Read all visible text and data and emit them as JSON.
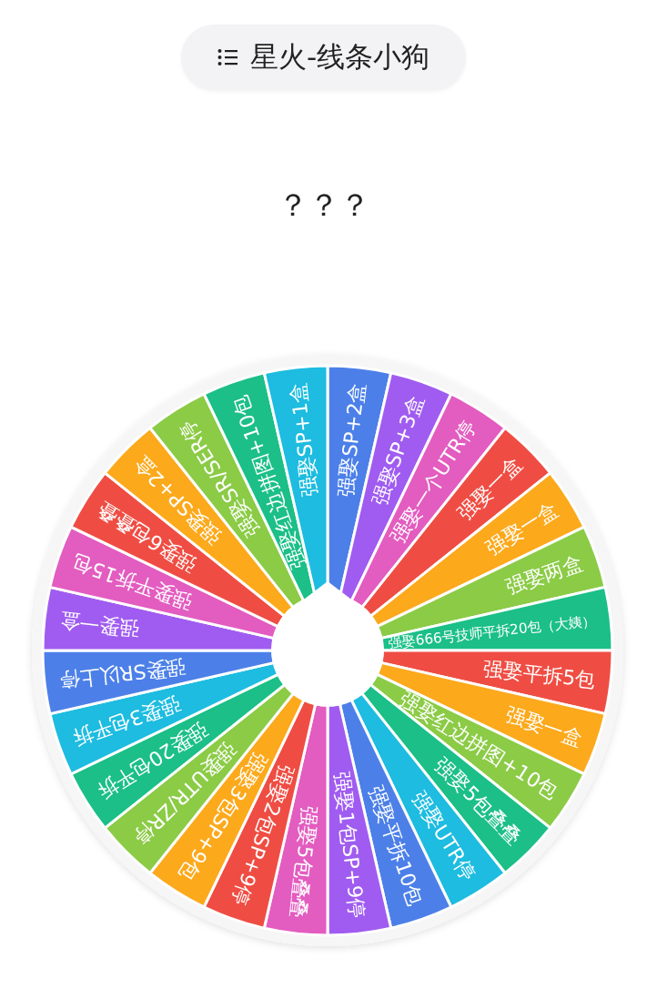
{
  "header": {
    "title": "星火-线条小狗"
  },
  "result": "？？？",
  "wheel": {
    "segments": [
      {
        "label": "强娶SP+2盒",
        "color": "#4c80e8"
      },
      {
        "label": "强娶SP+3盒",
        "color": "#a05cf0"
      },
      {
        "label": "强娶一个UTR停",
        "color": "#e35cc0"
      },
      {
        "label": "强娶一盒",
        "color": "#ef4d43"
      },
      {
        "label": "强娶一盒",
        "color": "#fca91c"
      },
      {
        "label": "强娶两盒",
        "color": "#8bcb46"
      },
      {
        "label": "强娶666号技师平拆20包（大姨）",
        "color": "#1bbf87"
      },
      {
        "label": "强娶平拆5包",
        "color": "#ef4d43"
      },
      {
        "label": "强娶一盒",
        "color": "#fca91c"
      },
      {
        "label": "强娶红边拼图+10包",
        "color": "#8bcb46"
      },
      {
        "label": "强娶5包叠叠",
        "color": "#1bbf87"
      },
      {
        "label": "强娶UTR停",
        "color": "#1dbce0"
      },
      {
        "label": "强娶平拆10包",
        "color": "#4c80e8"
      },
      {
        "label": "强娶1包SP+9停",
        "color": "#a05cf0"
      },
      {
        "label": "强娶5包叠叠",
        "color": "#e35cc0"
      },
      {
        "label": "强娶2包SP+9停",
        "color": "#ef4d43"
      },
      {
        "label": "强娶3包SP+9包",
        "color": "#fca91c"
      },
      {
        "label": "强娶UTR/ZR停",
        "color": "#8bcb46"
      },
      {
        "label": "强娶20包平拆",
        "color": "#1bbf87"
      },
      {
        "label": "强娶3包平拆",
        "color": "#1dbce0"
      },
      {
        "label": "强娶SR以上停",
        "color": "#4c80e8"
      },
      {
        "label": "强娶一盒",
        "color": "#a05cf0"
      },
      {
        "label": "强娶平拆15包",
        "color": "#e35cc0"
      },
      {
        "label": "强娶6包叠叠",
        "color": "#ef4d43"
      },
      {
        "label": "强娶SP+2盒",
        "color": "#fca91c"
      },
      {
        "label": "强娶SR/SER停",
        "color": "#8bcb46"
      },
      {
        "label": "强娶红边拼图+10包",
        "color": "#1bbf87"
      },
      {
        "label": "强娶SP+1盒",
        "color": "#1dbce0"
      }
    ]
  }
}
